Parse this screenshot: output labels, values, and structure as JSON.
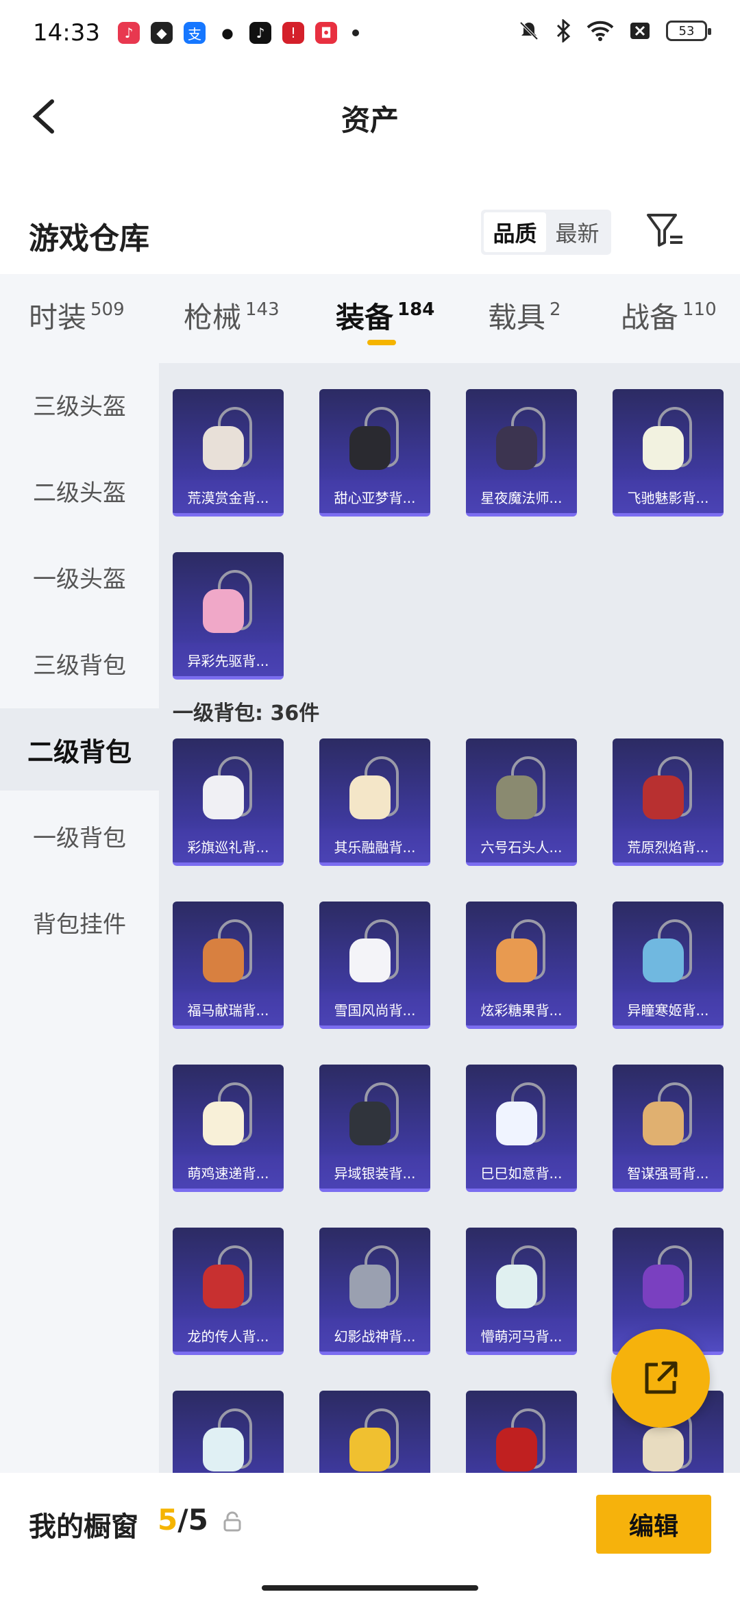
{
  "status_bar": {
    "time": "14:33",
    "battery": "53",
    "app_icons": [
      "music-icon",
      "shield-icon",
      "alipay-icon",
      "wechat-icon",
      "tiktok-icon",
      "red-app-icon",
      "shopping-bag-icon"
    ],
    "right_icons": [
      "mute-icon",
      "bluetooth-icon",
      "wifi-icon",
      "close-box-icon",
      "battery-icon"
    ]
  },
  "header": {
    "title": "资产"
  },
  "warehouse": {
    "title": "游戏仓库",
    "sort_options": [
      "品质",
      "最新"
    ],
    "active_sort": "品质"
  },
  "tabs": [
    {
      "label": "时装",
      "count": "509"
    },
    {
      "label": "枪械",
      "count": "143"
    },
    {
      "label": "装备",
      "count": "184"
    },
    {
      "label": "载具",
      "count": "2"
    },
    {
      "label": "战备",
      "count": "110"
    }
  ],
  "active_tab": "装备",
  "sidebar": [
    {
      "label": "三级头盔"
    },
    {
      "label": "二级头盔"
    },
    {
      "label": "一级头盔"
    },
    {
      "label": "三级背包"
    },
    {
      "label": "二级背包"
    },
    {
      "label": "一级背包"
    },
    {
      "label": "背包挂件"
    }
  ],
  "active_sidebar": "二级背包",
  "level2_items": [
    {
      "name": "荒漠赏金背...",
      "color": "#e8e0d8"
    },
    {
      "name": "甜心亚梦背...",
      "color": "#2a2a30"
    },
    {
      "name": "星夜魔法师...",
      "color": "#3c3450"
    },
    {
      "name": "飞驰魅影背...",
      "color": "#f2f2e0"
    },
    {
      "name": "异彩先驱背...",
      "color": "#f0a8c8"
    }
  ],
  "section": {
    "heading": "一级背包: 36件"
  },
  "level1_items": [
    {
      "name": "彩旗巡礼背...",
      "color": "#f0f0f4"
    },
    {
      "name": "其乐融融背...",
      "color": "#f4e6c8"
    },
    {
      "name": "六号石头人...",
      "color": "#8a8a70"
    },
    {
      "name": "荒原烈焰背...",
      "color": "#b83030"
    },
    {
      "name": "福马献瑞背...",
      "color": "#d88040"
    },
    {
      "name": "雪国风尚背...",
      "color": "#f4f4f8"
    },
    {
      "name": "炫彩糖果背...",
      "color": "#e89a50"
    },
    {
      "name": "异瞳寒姬背...",
      "color": "#70b8e0"
    },
    {
      "name": "萌鸡速递背...",
      "color": "#f8f0d8"
    },
    {
      "name": "异域银装背...",
      "color": "#30343c"
    },
    {
      "name": "巳巳如意背...",
      "color": "#f0f4ff"
    },
    {
      "name": "智谋强哥背...",
      "color": "#e0b070"
    },
    {
      "name": "龙的传人背...",
      "color": "#c83030"
    },
    {
      "name": "幻影战神背...",
      "color": "#9aa0b0"
    },
    {
      "name": "懵萌河马背...",
      "color": "#e0f0f0"
    },
    {
      "name": "",
      "color": "#7a40c0"
    },
    {
      "name": "",
      "color": "#e0f0f4"
    },
    {
      "name": "",
      "color": "#f0c030"
    },
    {
      "name": "",
      "color": "#c02020"
    },
    {
      "name": "",
      "color": "#e8dcc0"
    }
  ],
  "bottom_bar": {
    "label": "我的橱窗",
    "current": "5",
    "separator": "/",
    "total": "5",
    "edit_label": "编辑"
  },
  "colors": {
    "accent": "#f6b20c",
    "item_bg": "#3f3aa0"
  }
}
